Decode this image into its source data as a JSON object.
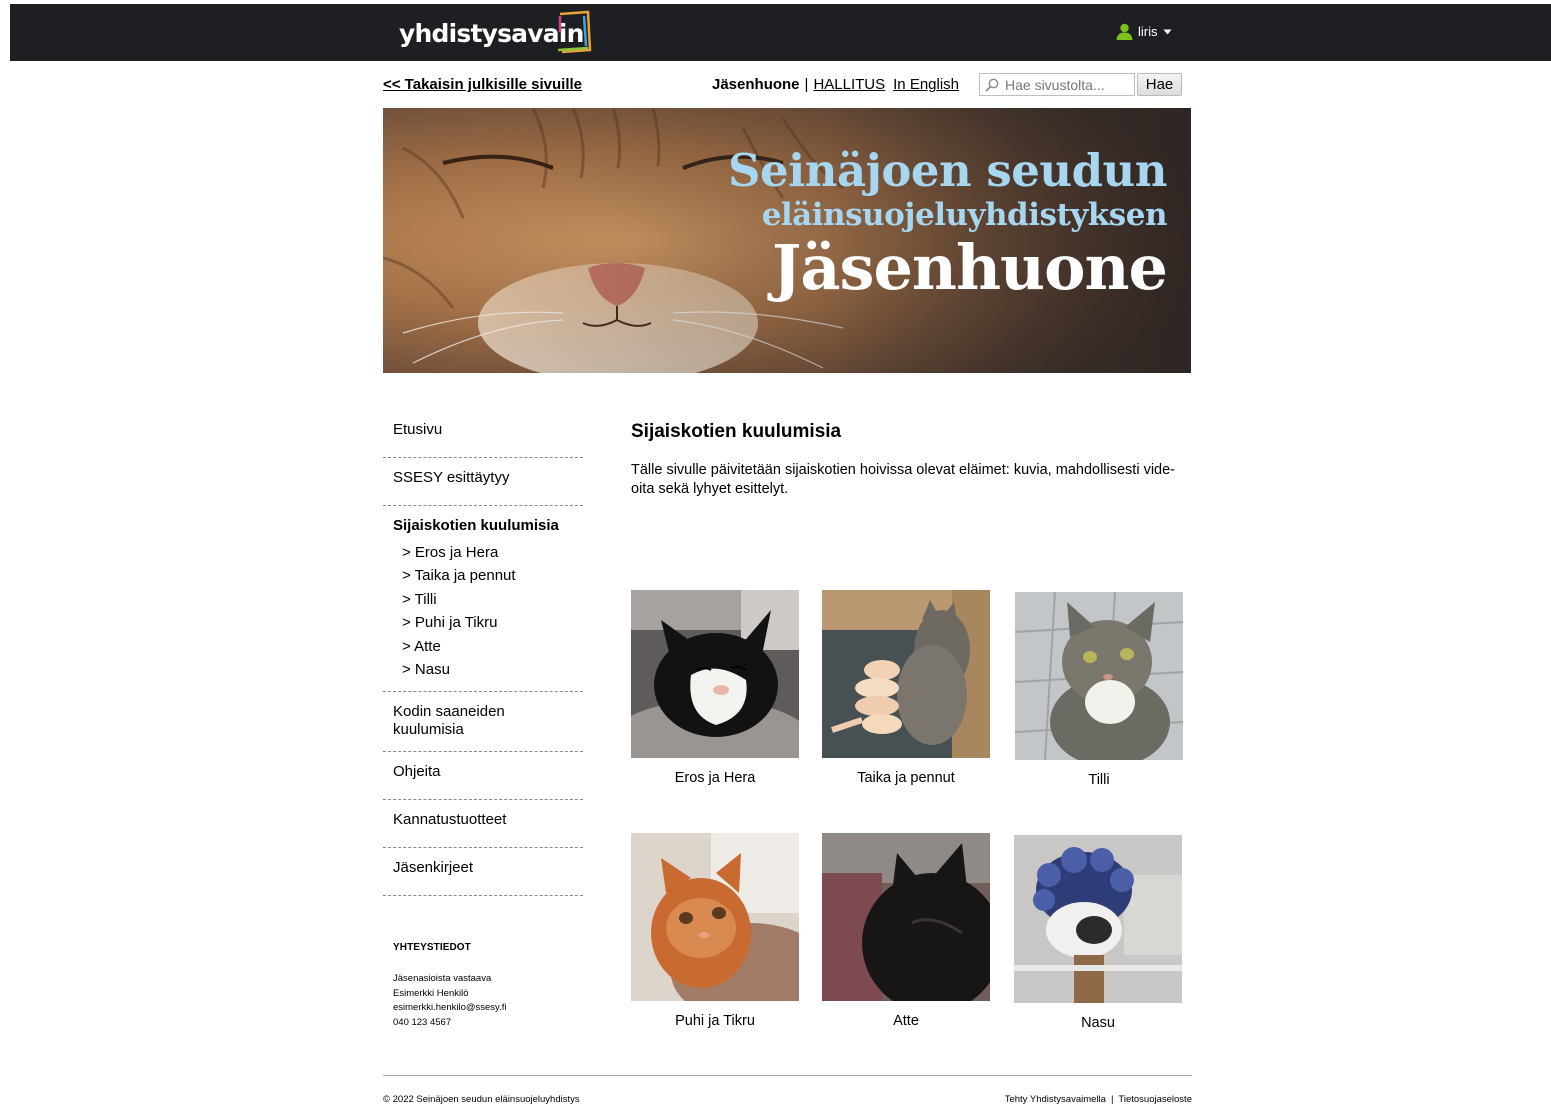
{
  "topbar": {
    "logo_text": "yhdistysavain",
    "user_name": "liris"
  },
  "subheader": {
    "back_link": "<< Takaisin julkisille sivuille",
    "current_section": "Jäsenhuone",
    "separator": "|",
    "link_board": "HALLITUS",
    "link_english": "In English",
    "search_placeholder": "Hae sivustolta...",
    "search_button": "Hae"
  },
  "banner": {
    "line1": "Seinäjoen seudun",
    "line2": "eläinsuojeluyhdistyksen",
    "line3": "Jäsenhuone"
  },
  "sidebar": {
    "items": [
      {
        "label": "Etusivu"
      },
      {
        "label": "SSESY esittäytyy"
      },
      {
        "label": "Sijaiskotien kuulumisia"
      },
      {
        "label": "Kodin saaneiden kuulumisia"
      },
      {
        "label": "Ohjeita"
      },
      {
        "label": "Kannatustuotteet"
      },
      {
        "label": "Jäsenkirjeet"
      }
    ],
    "subitems": [
      {
        "label": "> Eros ja Hera"
      },
      {
        "label": "> Taika ja pennut"
      },
      {
        "label": "> Tilli"
      },
      {
        "label": "> Puhi ja Tikru"
      },
      {
        "label": "> Atte"
      },
      {
        "label": "> Nasu"
      }
    ],
    "contact": {
      "heading": "YHTEYSTIEDOT",
      "role": "Jäsenasioista vastaava",
      "name": "Esimerkki Henkilö",
      "email": "esimerkki.henkilo@ssesy.fi",
      "phone": "040 123 4567"
    }
  },
  "main": {
    "title": "Sijaiskotien kuulumisia",
    "intro": "Tälle sivulle päivitetään sijaiskotien hoivissa olevat eläimet: kuvia, mahdollisesti vide-oita sekä lyhyet esittelyt.",
    "gallery": [
      {
        "caption": "Eros ja Hera"
      },
      {
        "caption": "Taika ja pennut"
      },
      {
        "caption": "Tilli"
      },
      {
        "caption": "Puhi ja Tikru"
      },
      {
        "caption": "Atte"
      },
      {
        "caption": "Nasu"
      }
    ]
  },
  "footer": {
    "copyright": "© 2022 Seinäjoen seudun eläinsuojeluyhdistys",
    "made_with": "Tehty Yhdistysavaimella",
    "separator": "|",
    "privacy": "Tietosuojaseloste"
  },
  "colors": {
    "topbar_bg": "#1e1f22",
    "banner_accent": "#a7d6f0",
    "user_icon": "#7cc21e"
  }
}
